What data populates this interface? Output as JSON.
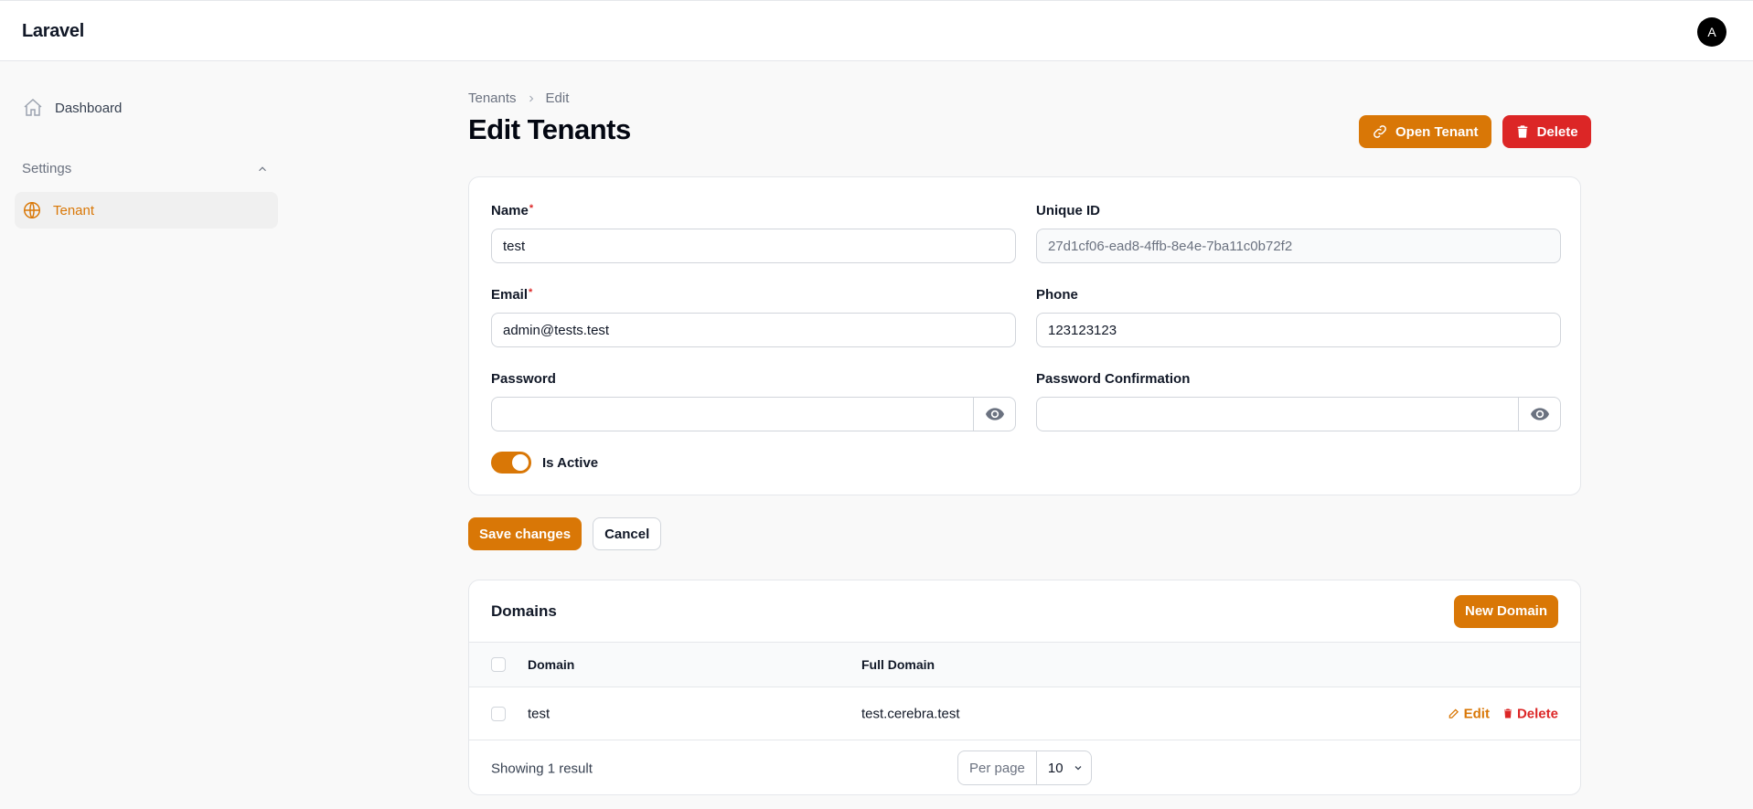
{
  "app": {
    "brand": "Laravel",
    "user_initial": "A"
  },
  "sidebar": {
    "dashboard": "Dashboard",
    "group_label": "Settings",
    "tenant": "Tenant"
  },
  "breadcrumb": {
    "parent": "Tenants",
    "current": "Edit"
  },
  "page": {
    "title": "Edit Tenants",
    "open_tenant": "Open Tenant",
    "delete": "Delete"
  },
  "form": {
    "name_label": "Name",
    "name_value": "test",
    "uid_label": "Unique ID",
    "uid_value": "27d1cf06-ead8-4ffb-8e4e-7ba11c0b72f2",
    "email_label": "Email",
    "email_value": "admin@tests.test",
    "phone_label": "Phone",
    "phone_value": "123123123",
    "password_label": "Password",
    "password_value": "",
    "password_confirm_label": "Password Confirmation",
    "password_confirm_value": "",
    "active_label": "Is Active",
    "active": true,
    "required_mark": "*",
    "save": "Save changes",
    "cancel": "Cancel"
  },
  "domains": {
    "title": "Domains",
    "new_button": "New Domain",
    "columns": [
      "Domain",
      "Full Domain"
    ],
    "rows": [
      {
        "domain": "test",
        "full_domain": "test.cerebra.test",
        "edit": "Edit",
        "delete": "Delete"
      }
    ],
    "summary": "Showing 1 result",
    "per_page_label": "Per page",
    "per_page_value": "10"
  },
  "colors": {
    "primary": "#d97706",
    "danger": "#dc2626"
  }
}
